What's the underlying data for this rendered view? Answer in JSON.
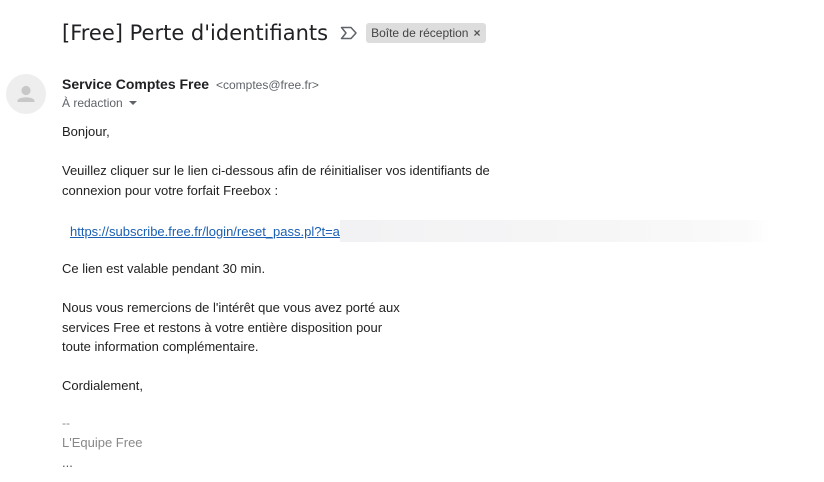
{
  "email": {
    "subject": "[Free] Perte d'identifiants",
    "label_chip": "Boîte de réception",
    "label_chip_close": "×",
    "sender_name": "Service Comptes Free",
    "sender_email": "<comptes@free.fr>",
    "recipient": "À redaction",
    "greeting": "Bonjour,",
    "paragraph1_line1": "Veuillez cliquer sur le lien ci-dessous afin de réinitialiser vos identifiants de",
    "paragraph1_line2": "connexion pour votre forfait Freebox  :",
    "reset_link": "https://subscribe.free.fr/login/reset_pass.pl?t=a",
    "validity": "Ce lien est valable pendant 30 min.",
    "thanks_line1": "Nous vous remercions de l'intérêt que vous avez porté aux",
    "thanks_line2": "services Free et restons à votre entière disposition pour",
    "thanks_line3": "toute information complémentaire.",
    "closing": "Cordialement,",
    "signature_dash": "--",
    "signature_team": "L'Equipe Free",
    "show_trimmed": "..."
  },
  "icons": {
    "important": "important-marker-icon",
    "avatar": "person-avatar-icon",
    "caret": "dropdown-caret-icon"
  },
  "colors": {
    "link": "#1a5fb4",
    "chip_background": "#dddddd",
    "secondary_text": "#5f6368",
    "signature_text": "#888888"
  }
}
